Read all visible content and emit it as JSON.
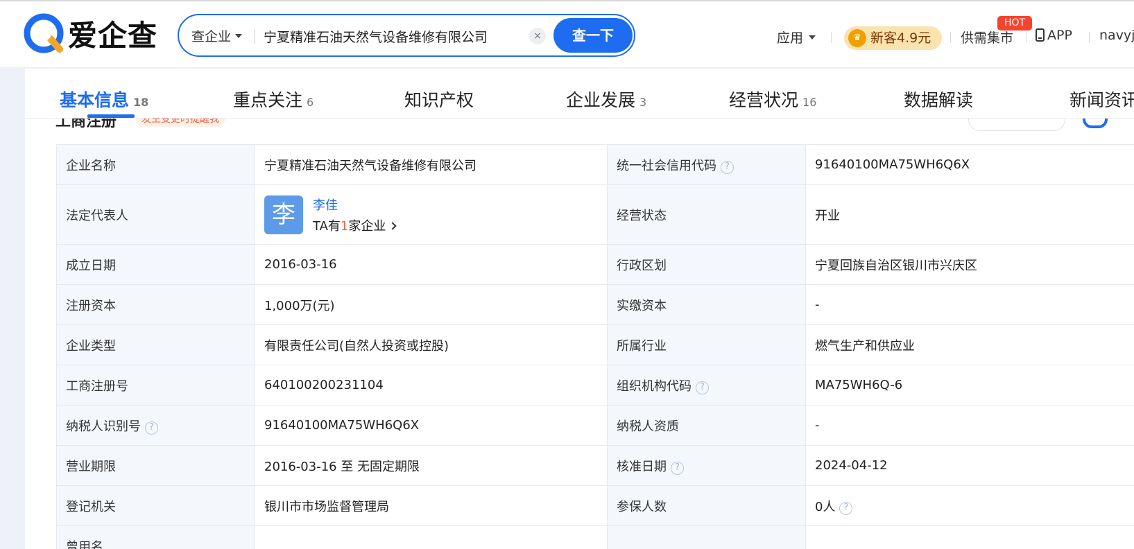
{
  "brand": {
    "name": "爱企查"
  },
  "search": {
    "type_label": "查企业",
    "query": "宁夏精准石油天然气设备维修有限公司",
    "clear_glyph": "×",
    "button_label": "查一下"
  },
  "nav": {
    "apps_label": "应用",
    "promo_label": "新客4.9元",
    "supply_label": "供需集市",
    "hot_badge": "HOT",
    "app_label": "APP",
    "user_label": "navyj"
  },
  "tabs": [
    {
      "label": "基本信息",
      "count": "18"
    },
    {
      "label": "重点关注",
      "count": "6"
    },
    {
      "label": "知识产权",
      "count": ""
    },
    {
      "label": "企业发展",
      "count": "3"
    },
    {
      "label": "经营状况",
      "count": "16"
    },
    {
      "label": "数据解读",
      "count": ""
    },
    {
      "label": "新闻资讯",
      "count": ""
    }
  ],
  "section": {
    "heading": "工商注册",
    "tag": "发生变更时提醒我"
  },
  "rep": {
    "avatar_char": "李",
    "name": "李佳",
    "sub_prefix": "TA有",
    "sub_num": "1",
    "sub_suffix": "家企业"
  },
  "rows": [
    {
      "l1": "企业名称",
      "v1": "宁夏精准石油天然气设备维修有限公司",
      "l2": "统一社会信用代码",
      "v2": "91640100MA75WH6Q6X"
    },
    {
      "l1": "法定代表人",
      "v1": "",
      "l2": "经营状态",
      "v2": "开业"
    },
    {
      "l1": "成立日期",
      "v1": "2016-03-16",
      "l2": "行政区划",
      "v2": "宁夏回族自治区银川市兴庆区"
    },
    {
      "l1": "注册资本",
      "v1": "1,000万(元)",
      "l2": "实缴资本",
      "v2": "-"
    },
    {
      "l1": "企业类型",
      "v1": "有限责任公司(自然人投资或控股)",
      "l2": "所属行业",
      "v2": "燃气生产和供应业"
    },
    {
      "l1": "工商注册号",
      "v1": "640100200231104",
      "l2": "组织机构代码",
      "v2": "MA75WH6Q-6"
    },
    {
      "l1": "纳税人识别号",
      "v1": "91640100MA75WH6Q6X",
      "l2": "纳税人资质",
      "v2": "-"
    },
    {
      "l1": "营业期限",
      "v1": "2016-03-16 至 无固定期限",
      "l2": "核准日期",
      "v2": "2024-04-12"
    },
    {
      "l1": "登记机关",
      "v1": "银川市市场监督管理局",
      "l2": "参保人数",
      "v2": "0人"
    },
    {
      "l1": "曾用名",
      "v1": "",
      "l2": "",
      "v2": ""
    }
  ],
  "help_glyph": "?",
  "colors": {
    "accent": "#1e6cf0",
    "highlight": "#f0623a",
    "label_bg": "#f4f7fc"
  }
}
